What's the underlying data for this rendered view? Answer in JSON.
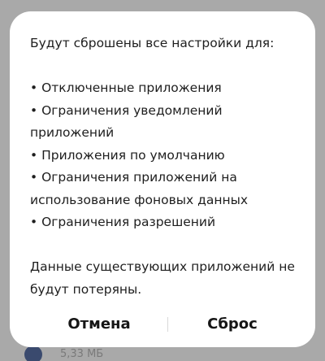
{
  "background": {
    "item_size_text": "5,33 МБ"
  },
  "dialog": {
    "intro": "Будут сброшены все настройки для:",
    "items": [
      "• Отключенные приложения",
      "• Ограничения уведомлений",
      "приложений",
      "• Приложения по умолчанию",
      "• Ограничения приложений на",
      "использование фоновых данных",
      "• Ограничения разрешений"
    ],
    "note_lines": [
      "Данные существующих приложений не",
      "будут потеряны."
    ],
    "cancel_label": "Отмена",
    "reset_label": "Сброс"
  },
  "colors": {
    "scrim": "#a9a9a9",
    "dialog_bg": "#ffffff",
    "text": "#1e1e1e"
  }
}
